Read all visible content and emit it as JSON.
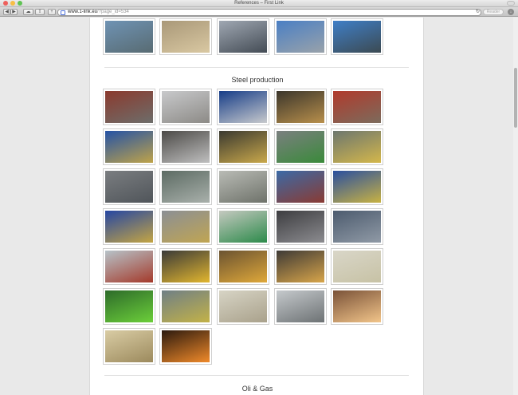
{
  "window": {
    "title": "References – First Link",
    "colors": {
      "close": "#ee5f5b",
      "minimize": "#f7be45",
      "zoom": "#5fc353"
    }
  },
  "toolbar": {
    "back_icon": "chevron-left-icon",
    "forward_icon": "chevron-right-icon",
    "cloud_icon": "icloud-icon",
    "share_icon": "share-icon",
    "add_icon": "plus-icon",
    "url_host": "www.1-link.eu",
    "url_path": "/?page_id=534",
    "reload_icon": "reload-icon",
    "reader_label": "Reader",
    "downloads_icon": "download-icon"
  },
  "sections": {
    "steel_title": "Steel production",
    "oil_title": "Oli & Gas"
  },
  "gallery": [
    {
      "row": 0,
      "col": 0,
      "c1": "#6f93b4",
      "c2": "#586b72"
    },
    {
      "row": 0,
      "col": 1,
      "c1": "#a99878",
      "c2": "#d9c8a2"
    },
    {
      "row": 0,
      "col": 2,
      "c1": "#9fa7b2",
      "c2": "#444c55"
    },
    {
      "row": 0,
      "col": 3,
      "c1": "#4a7fc4",
      "c2": "#99a2aa"
    },
    {
      "row": 0,
      "col": 4,
      "c1": "#3f7fc7",
      "c2": "#3c4a52"
    },
    {
      "row": 1,
      "col": 0,
      "c1": "#8b3a2e",
      "c2": "#6d6d6a"
    },
    {
      "row": 1,
      "col": 1,
      "c1": "#c8c9cb",
      "c2": "#8c8a86"
    },
    {
      "row": 1,
      "col": 2,
      "c1": "#163d88",
      "c2": "#c7c9cc"
    },
    {
      "row": 1,
      "col": 3,
      "c1": "#3b362c",
      "c2": "#b88f4b"
    },
    {
      "row": 1,
      "col": 4,
      "c1": "#b13a2c",
      "c2": "#7c6b5c"
    },
    {
      "row": 2,
      "col": 0,
      "c1": "#2452a6",
      "c2": "#bfa349"
    },
    {
      "row": 2,
      "col": 1,
      "c1": "#4c4a47",
      "c2": "#bfbfbf"
    },
    {
      "row": 2,
      "col": 2,
      "c1": "#3a3930",
      "c2": "#c9a84b"
    },
    {
      "row": 2,
      "col": 3,
      "c1": "#7b7f80",
      "c2": "#3a8a3a"
    },
    {
      "row": 2,
      "col": 4,
      "c1": "#6c766f",
      "c2": "#d4b74b"
    },
    {
      "row": 3,
      "col": 0,
      "c1": "#7a7d80",
      "c2": "#50555a"
    },
    {
      "row": 3,
      "col": 1,
      "c1": "#5c6b63",
      "c2": "#a9b0ab"
    },
    {
      "row": 3,
      "col": 2,
      "c1": "#b9bbb5",
      "c2": "#6e726a"
    },
    {
      "row": 3,
      "col": 3,
      "c1": "#3b6aa6",
      "c2": "#8a3b33"
    },
    {
      "row": 3,
      "col": 4,
      "c1": "#2a4f9f",
      "c2": "#c8b243"
    },
    {
      "row": 4,
      "col": 0,
      "c1": "#2546a3",
      "c2": "#c4a543"
    },
    {
      "row": 4,
      "col": 1,
      "c1": "#8b8f95",
      "c2": "#c0a552"
    },
    {
      "row": 4,
      "col": 2,
      "c1": "#c5c9c0",
      "c2": "#2c8a4a"
    },
    {
      "row": 4,
      "col": 3,
      "c1": "#3d3d40",
      "c2": "#8c8c90"
    },
    {
      "row": 4,
      "col": 4,
      "c1": "#4c5b6e",
      "c2": "#909aa6"
    },
    {
      "row": 5,
      "col": 0,
      "c1": "#b7c3c9",
      "c2": "#a43a2b"
    },
    {
      "row": 5,
      "col": 1,
      "c1": "#3a3a38",
      "c2": "#e2b62f"
    },
    {
      "row": 5,
      "col": 2,
      "c1": "#6b5331",
      "c2": "#dfa83a"
    },
    {
      "row": 5,
      "col": 3,
      "c1": "#3e3a36",
      "c2": "#d8a54a"
    },
    {
      "row": 5,
      "col": 4,
      "c1": "#d9d6c8",
      "c2": "#c7c2a5"
    },
    {
      "row": 6,
      "col": 0,
      "c1": "#2d6b2a",
      "c2": "#6ccf3a"
    },
    {
      "row": 6,
      "col": 1,
      "c1": "#6f7f86",
      "c2": "#c3b247"
    },
    {
      "row": 6,
      "col": 2,
      "c1": "#d7d4c5",
      "c2": "#a9a18b"
    },
    {
      "row": 6,
      "col": 3,
      "c1": "#c5c9cc",
      "c2": "#6d7274"
    },
    {
      "row": 6,
      "col": 4,
      "c1": "#7a5238",
      "c2": "#f2c58a"
    },
    {
      "row": 7,
      "col": 0,
      "c1": "#d9cca4",
      "c2": "#9c8a5d"
    },
    {
      "row": 7,
      "col": 1,
      "c1": "#2c1a0e",
      "c2": "#f08a2a"
    }
  ]
}
